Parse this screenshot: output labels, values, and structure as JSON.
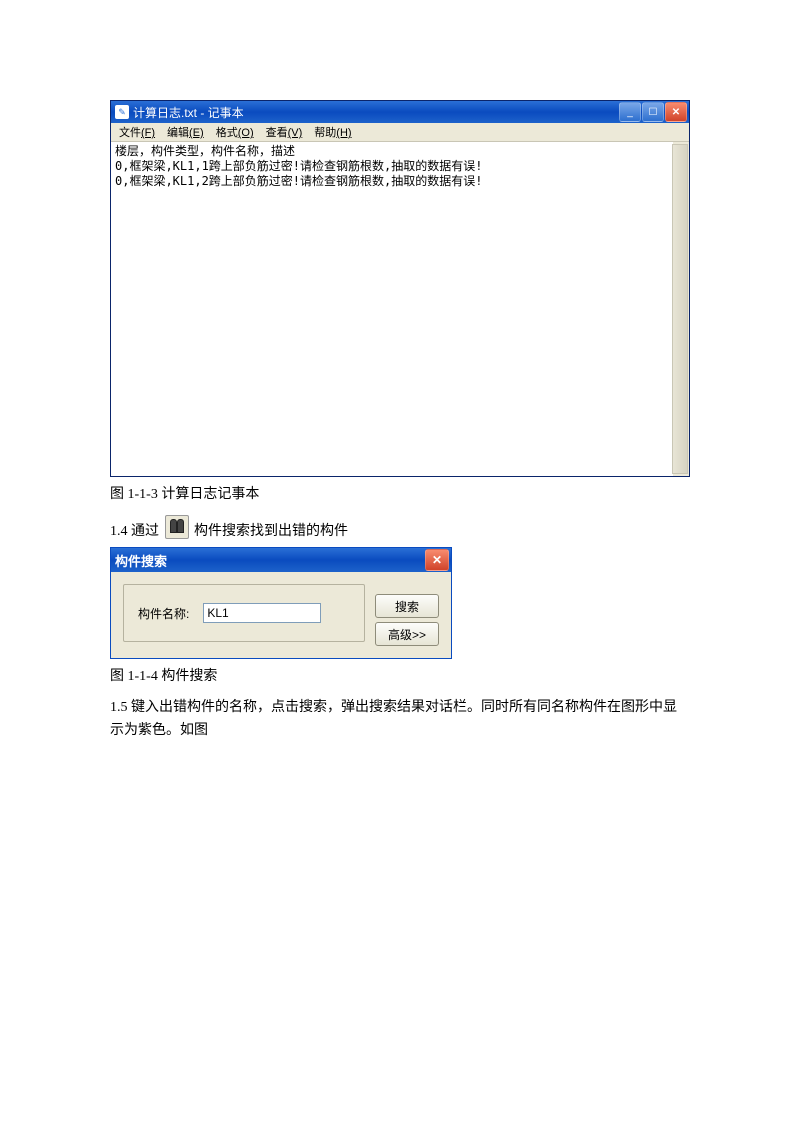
{
  "notepad": {
    "title": "计算日志.txt - 记事本",
    "menus": {
      "file": {
        "label": "文件",
        "accel": "(F)"
      },
      "edit": {
        "label": "编辑",
        "accel": "(E)"
      },
      "format": {
        "label": "格式",
        "accel": "(O)"
      },
      "view": {
        "label": "查看",
        "accel": "(V)"
      },
      "help": {
        "label": "帮助",
        "accel": "(H)"
      }
    },
    "content": {
      "line1": "楼层，构件类型，构件名称，描述",
      "line2": "0,框架梁,KL1,1跨上部负筋过密!请检查钢筋根数,抽取的数据有误!",
      "line3": "0,框架梁,KL1,2跨上部负筋过密!请检查钢筋根数,抽取的数据有误!"
    }
  },
  "caption1": "图 1-1-3 计算日志记事本",
  "para_1_4_before": "1.4 通过 ",
  "para_1_4_after": " 构件搜索找到出错的构件",
  "search_dialog": {
    "title": "构件搜索",
    "label": "构件名称:",
    "input_value": "KL1",
    "btn_search": "搜索",
    "btn_advanced": "高级>>"
  },
  "caption2": "图 1-1-4 构件搜索",
  "para_1_5": "1.5 键入出错构件的名称，点击搜索，弹出搜索结果对话栏。同时所有同名称构件在图形中显示为紫色。如图"
}
